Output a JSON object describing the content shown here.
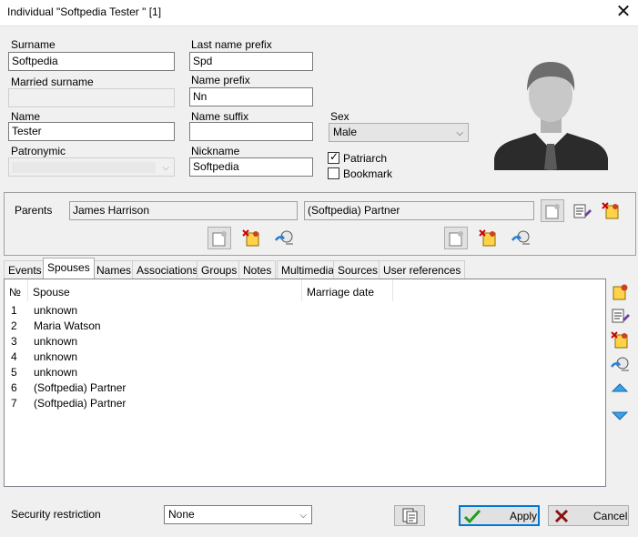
{
  "window": {
    "title": "Individual \"Softpedia Tester \" [1]"
  },
  "fields": {
    "surname": {
      "label": "Surname",
      "value": "Softpedia"
    },
    "married_surname": {
      "label": "Married surname",
      "value": ""
    },
    "name": {
      "label": "Name",
      "value": "Tester"
    },
    "patronymic": {
      "label": "Patronymic",
      "value": ""
    },
    "last_name_prefix": {
      "label": "Last name prefix",
      "value": "Spd"
    },
    "name_prefix": {
      "label": "Name prefix",
      "value": "Nn"
    },
    "name_suffix": {
      "label": "Name suffix",
      "value": ""
    },
    "nickname": {
      "label": "Nickname",
      "value": "Softpedia"
    },
    "sex": {
      "label": "Sex",
      "value": "Male"
    },
    "patriarch": {
      "label": "Patriarch",
      "checked": true
    },
    "bookmark": {
      "label": "Bookmark",
      "checked": false
    }
  },
  "parents": {
    "label": "Parents",
    "father": "James Harrison",
    "mother": "(Softpedia) Partner"
  },
  "tabs": [
    "Events",
    "Spouses",
    "Names",
    "Associations",
    "Groups",
    "Notes",
    "Multimedia",
    "Sources",
    "User references"
  ],
  "active_tab": "Spouses",
  "spouses": {
    "columns": [
      "№",
      "Spouse",
      "Marriage date"
    ],
    "rows": [
      {
        "n": "1",
        "spouse": "unknown",
        "date": ""
      },
      {
        "n": "2",
        "spouse": "Maria Watson",
        "date": ""
      },
      {
        "n": "3",
        "spouse": "unknown",
        "date": ""
      },
      {
        "n": "4",
        "spouse": "unknown",
        "date": ""
      },
      {
        "n": "5",
        "spouse": "unknown",
        "date": ""
      },
      {
        "n": "6",
        "spouse": "(Softpedia) Partner",
        "date": ""
      },
      {
        "n": "7",
        "spouse": "(Softpedia) Partner",
        "date": ""
      }
    ]
  },
  "footer": {
    "security_label": "Security restriction",
    "security_value": "None",
    "apply": "Apply",
    "cancel": "Cancel"
  },
  "colors": {
    "accent": "#0078d7",
    "add": "#d04020",
    "delete": "#cc0000",
    "apply_check": "#1e9e1e"
  },
  "icons": [
    "close-icon",
    "avatar-placeholder-icon",
    "add-record-icon",
    "edit-record-icon",
    "delete-record-icon",
    "select-record-icon",
    "move-up-icon",
    "move-down-icon",
    "copy-icon",
    "check-icon",
    "cross-icon",
    "chevron-down-icon",
    "checkmark-icon"
  ]
}
